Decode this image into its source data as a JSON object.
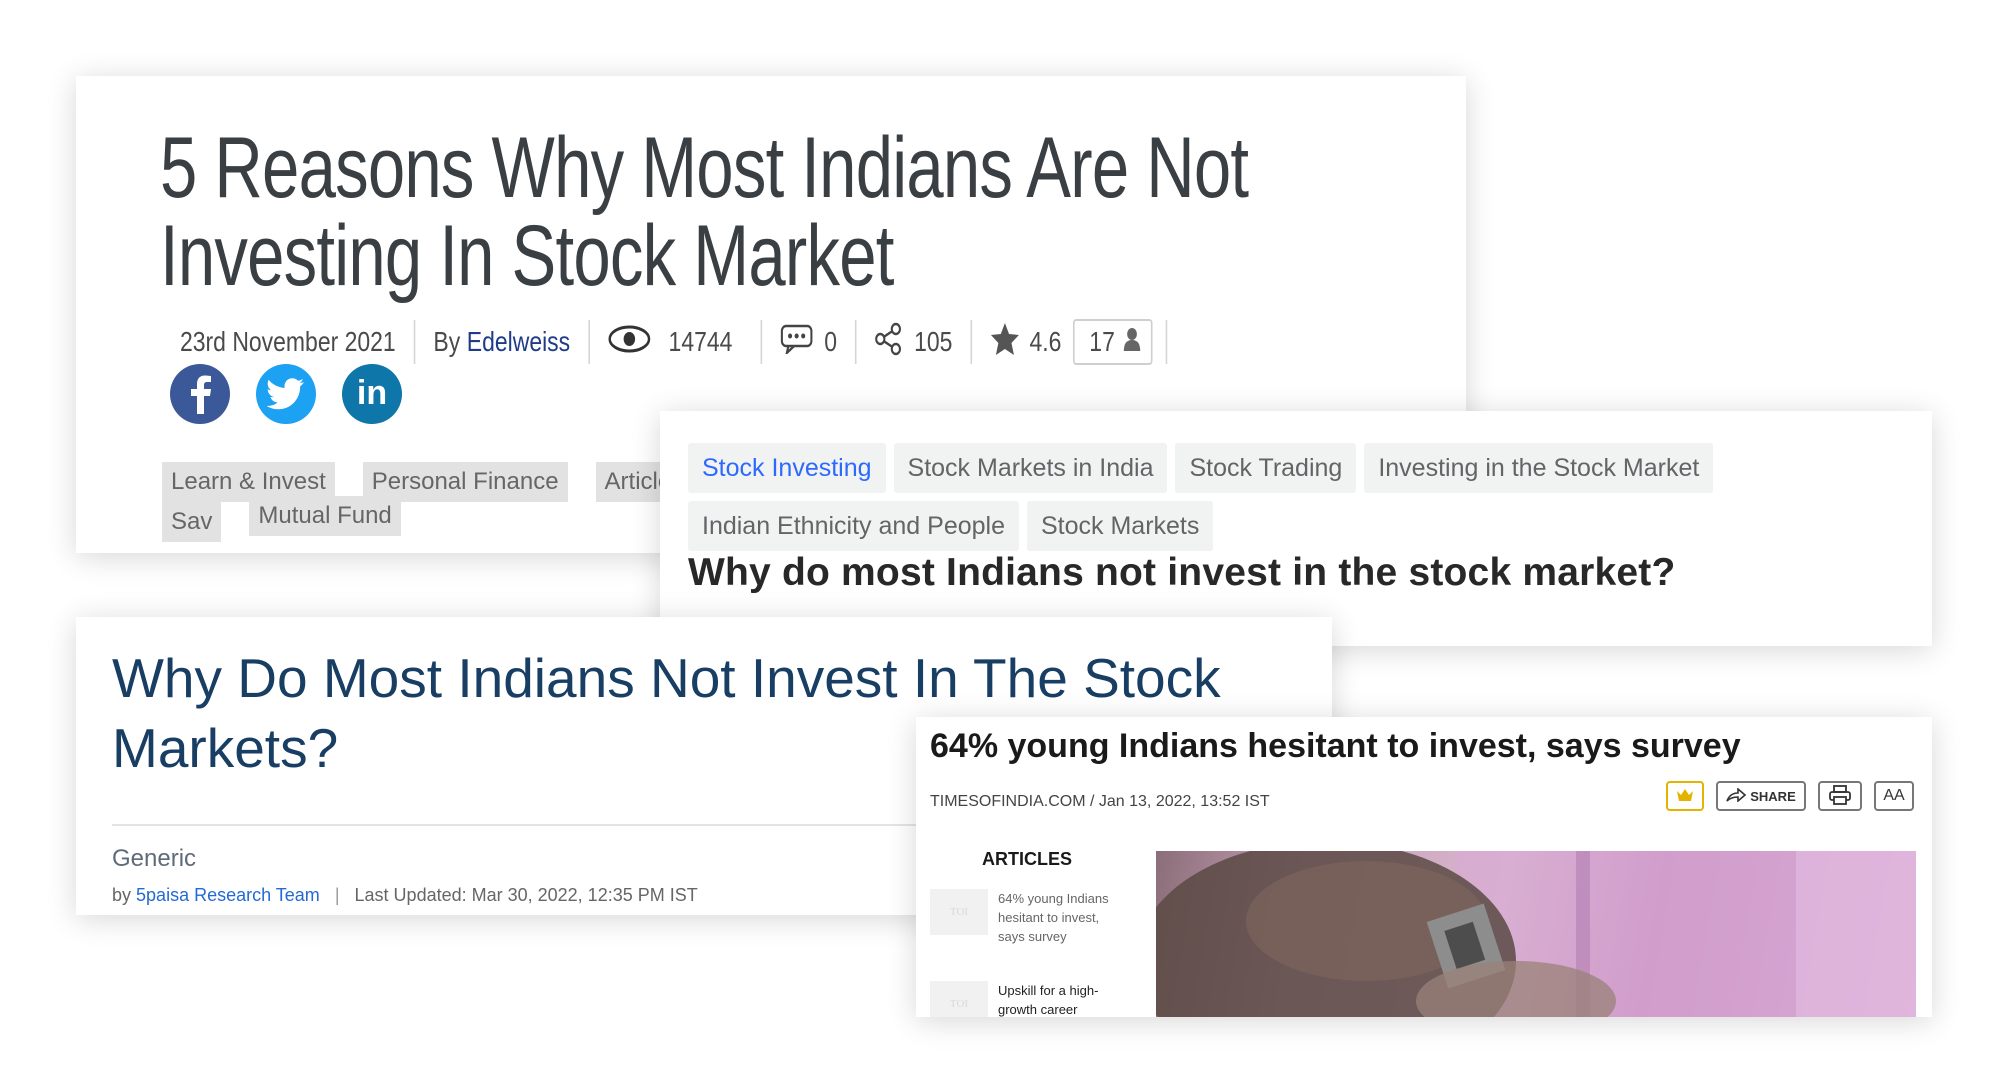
{
  "edelweiss": {
    "title_line1": "5 Reasons Why Most Indians Are Not",
    "title_line2": "Investing In Stock Market",
    "date": "23rd November 2021",
    "by_label": "By",
    "author": "Edelweiss",
    "views": "14744",
    "comments": "0",
    "shares": "105",
    "rating": "4.6",
    "rating_count": "17",
    "social": [
      {
        "name": "facebook",
        "glyph": "f",
        "color": "#3b5998"
      },
      {
        "name": "twitter",
        "glyph": "t",
        "color": "#1da1f2"
      },
      {
        "name": "linkedin",
        "glyph": "in",
        "color": "#0e76a8"
      }
    ],
    "tags": [
      "Learn & Invest",
      "Personal Finance",
      "Article",
      "Sav",
      "Mutual Fund"
    ]
  },
  "quora": {
    "topics": [
      "Stock Investing",
      "Stock Markets in India",
      "Stock Trading",
      "Investing in the Stock Market",
      "Indian Ethnicity and People",
      "Stock Markets"
    ],
    "question": "Why do most Indians not invest in the stock market?",
    "active_color": "#2e69ff"
  },
  "fivepaisa": {
    "title": "Why Do Most Indians Not Invest In The Stock Markets?",
    "category": "Generic",
    "by_label": "by",
    "team": "5paisa Research Team",
    "separator": "|",
    "updated": "Last Updated: Mar 30, 2022, 12:35 PM IST"
  },
  "toi": {
    "headline": "64% young Indians hesitant to invest, says survey",
    "source": "TIMESOFINDIA.COM / Jan 13, 2022, 13:52 IST",
    "share_label": "SHARE",
    "font_label": "AA",
    "articles_heading": "ARTICLES",
    "thumb_label": "TOI",
    "articles": [
      {
        "title": "64% young Indians hesitant to invest, says survey"
      },
      {
        "title": "Upskill for a high-growth career"
      }
    ]
  }
}
